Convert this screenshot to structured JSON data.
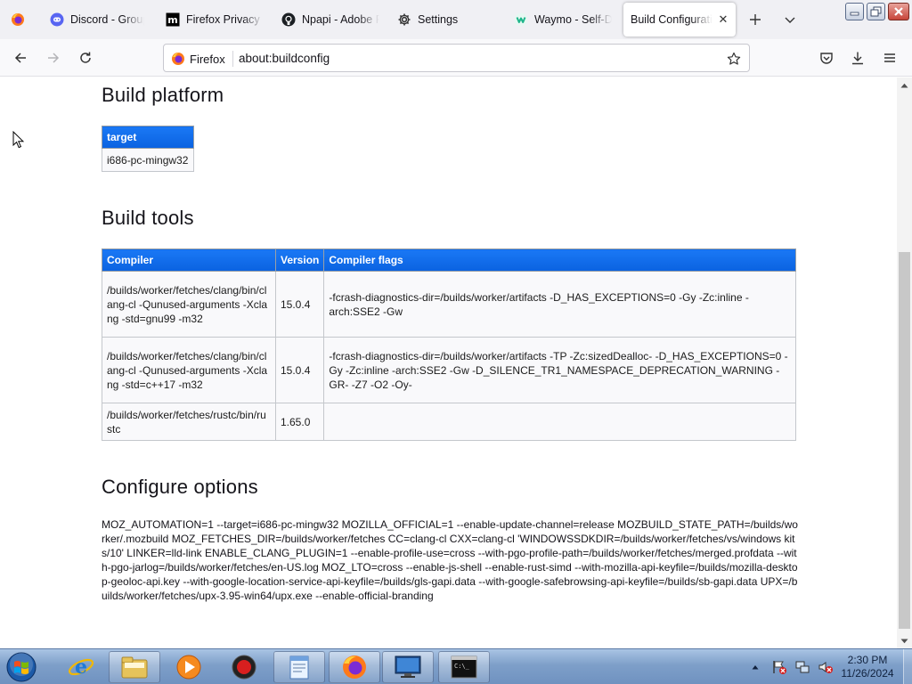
{
  "tabs": [
    {
      "title": "",
      "favicon": "firefox-icon",
      "pinned": true
    },
    {
      "title": "Discord - Group",
      "favicon": "discord-icon"
    },
    {
      "title": "Firefox Privacy N",
      "favicon": "mozilla-icon"
    },
    {
      "title": "Npapi - Adobe F",
      "favicon": "github-icon"
    },
    {
      "title": "Settings",
      "favicon": "gear-icon"
    },
    {
      "title": "Waymo - Self-Dr",
      "favicon": "waymo-icon"
    },
    {
      "title": "Build Configuratio",
      "favicon": "none",
      "active": true
    }
  ],
  "urlbar": {
    "identity_label": "Firefox",
    "url": "about:buildconfig"
  },
  "sections": {
    "platform_title": "Build platform",
    "tools_title": "Build tools",
    "configure_title": "Configure options"
  },
  "platform_table": {
    "header": "target",
    "value": "i686-pc-mingw32"
  },
  "tools_table": {
    "headers": [
      "Compiler",
      "Version",
      "Compiler flags"
    ],
    "rows": [
      {
        "compiler": "/builds/worker/fetches/clang/bin/clang-cl -Qunused-arguments -Xclang -std=gnu99 -m32",
        "version": "15.0.4",
        "flags": "-fcrash-diagnostics-dir=/builds/worker/artifacts -D_HAS_EXCEPTIONS=0 -Gy -Zc:inline -arch:SSE2 -Gw"
      },
      {
        "compiler": "/builds/worker/fetches/clang/bin/clang-cl -Qunused-arguments -Xclang -std=c++17 -m32",
        "version": "15.0.4",
        "flags": "-fcrash-diagnostics-dir=/builds/worker/artifacts -TP -Zc:sizedDealloc- -D_HAS_EXCEPTIONS=0 -Gy -Zc:inline -arch:SSE2 -Gw -D_SILENCE_TR1_NAMESPACE_DEPRECATION_WARNING -GR- -Z7 -O2 -Oy-"
      },
      {
        "compiler": "/builds/worker/fetches/rustc/bin/rustc",
        "version": "1.65.0",
        "flags": ""
      }
    ]
  },
  "configure_options": "MOZ_AUTOMATION=1 --target=i686-pc-mingw32 MOZILLA_OFFICIAL=1 --enable-update-channel=release MOZBUILD_STATE_PATH=/builds/worker/.mozbuild MOZ_FETCHES_DIR=/builds/worker/fetches CC=clang-cl CXX=clang-cl 'WINDOWSSDKDIR=/builds/worker/fetches/vs/windows kits/10' LINKER=lld-link ENABLE_CLANG_PLUGIN=1 --enable-profile-use=cross --with-pgo-profile-path=/builds/worker/fetches/merged.profdata --with-pgo-jarlog=/builds/worker/fetches/en-US.log MOZ_LTO=cross --enable-js-shell --enable-rust-simd --with-mozilla-api-keyfile=/builds/mozilla-desktop-geoloc-api.key --with-google-location-service-api-keyfile=/builds/gls-gapi.data --with-google-safebrowsing-api-keyfile=/builds/sb-gapi.data UPX=/builds/worker/fetches/upx-3.95-win64/upx.exe --enable-official-branding",
  "taskbar": {
    "items": [
      "start-orb",
      "internet-explorer",
      "file-explorer",
      "media-player",
      "record-app",
      "notepad-app",
      "firefox",
      "remote-desktop",
      "command-prompt"
    ],
    "clock_time": "2:30 PM",
    "clock_date": "11/26/2024"
  },
  "colors": {
    "accent": "#0a62e0",
    "tabstrip": "#f0f0f4",
    "taskbar": "#7e9fc9"
  }
}
